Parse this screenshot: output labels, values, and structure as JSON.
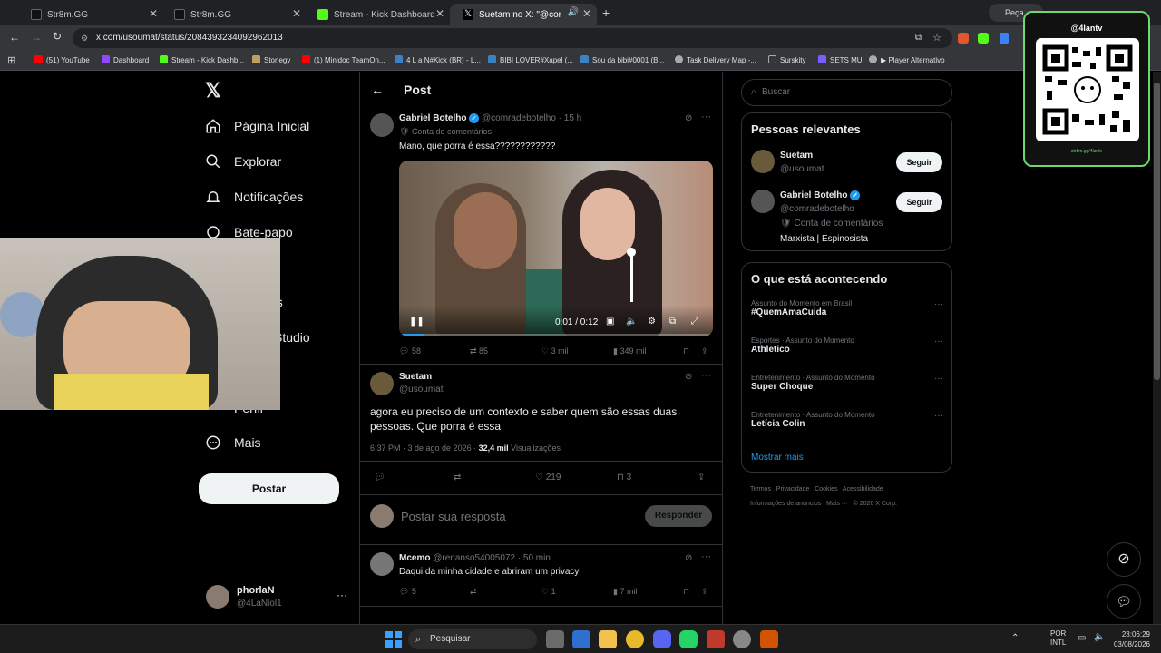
{
  "browser": {
    "tabs": [
      {
        "label": "Str8m.GG",
        "icon_color": "#111111"
      },
      {
        "label": "Str8m.GG",
        "icon_color": "#111111"
      },
      {
        "label": "Stream - Kick Dashboard",
        "icon_color": "#53fc18"
      },
      {
        "label": "Suetam no X: \"@comradeb",
        "icon_color": "#000000"
      }
    ],
    "right_tab": "Peça",
    "url": "x.com/usoumat/status/2084393234092962013",
    "bookmarks": [
      {
        "label": "(51) YouTube",
        "color": "#ff0000"
      },
      {
        "label": "Dashboard",
        "color": "#9147ff"
      },
      {
        "label": "Stream - Kick Dashb...",
        "color": "#53fc18"
      },
      {
        "label": "Stonegy",
        "color": "#c0a060"
      },
      {
        "label": "(1) Minidoc TeamOn...",
        "color": "#ff0000"
      },
      {
        "label": "4 L a N#Kick (BR) - L...",
        "color": "#3b82c4"
      },
      {
        "label": "BIBI LOVER#Xapel (...",
        "color": "#3b82c4"
      },
      {
        "label": "Sou da bibi#0001 (B...",
        "color": "#3b82c4"
      },
      {
        "label": "Task Delivery Map -...",
        "color": "#aaaaaa"
      },
      {
        "label": "Surskity",
        "color": "#aaaaaa"
      },
      {
        "label": "SETS MU",
        "color": "#7a5cff"
      },
      {
        "label": "▶ Player Alternativo",
        "color": "#aaaaaa"
      }
    ]
  },
  "nav": {
    "items": [
      {
        "label": "Página Inicial",
        "icon": "home-icon"
      },
      {
        "label": "Explorar",
        "icon": "search-icon"
      },
      {
        "label": "Notificações",
        "icon": "bell-icon"
      },
      {
        "label": "Bate-papo",
        "icon": "chat-icon"
      },
      {
        "label": "vos",
        "icon": ""
      },
      {
        "label": "Studio",
        "icon": ""
      },
      {
        "label": "Perfil",
        "icon": "profile-icon"
      },
      {
        "label": "Mais",
        "icon": "more-icon"
      }
    ],
    "post_button": "Postar",
    "account_name": "phorlaN",
    "account_handle": "@4LaNlol1"
  },
  "main": {
    "title": "Post",
    "quoted": {
      "name": "Gabriel Botelho",
      "handle": "@comradebotelho",
      "time": "· 15 h",
      "badge": "Conta de comentários",
      "text": "Mano, que porra é essa????????????",
      "video_time": "0:01 / 0:12",
      "video_progress": 0.08,
      "replies": "58",
      "reposts": "85",
      "likes": "3 mil",
      "views": "349 mil"
    },
    "post": {
      "name": "Suetam",
      "handle": "@usoumat",
      "text": "agora eu preciso de um contexto e saber quem são essas duas pessoas. Que porra é essa",
      "timestamp": "6:37 PM · 3 de ago de 2026 ·",
      "views_count": "32,4 mil",
      "views_label": "Visualizações",
      "likes": "219",
      "bookmarks": "3"
    },
    "reply_placeholder": "Postar sua resposta",
    "reply_button": "Responder",
    "reply": {
      "name": "Mcemo",
      "handle": "@renanso54005072",
      "time": "· 50 min",
      "text": "Daqui da minha cidade e abriram um privacy",
      "replies": "5",
      "likes": "1",
      "views": "7 mil"
    }
  },
  "sidebar": {
    "search_placeholder": "Buscar",
    "relevant_title": "Pessoas relevantes",
    "people": [
      {
        "name": "Suetam",
        "handle": "@usoumat",
        "button": "Seguir"
      },
      {
        "name": "Gabriel Botelho",
        "handle": "@comradebotelho",
        "badge": "Conta de comentários",
        "bio": "Marxista | Espinosista",
        "button": "Seguir"
      }
    ],
    "trends_title": "O que está acontecendo",
    "trends": [
      {
        "meta": "Assunto do Momento em Brasil",
        "title": "#QuemAmaCuida"
      },
      {
        "meta": "Esportes · Assunto do Momento",
        "title": "Athletico"
      },
      {
        "meta": "Entretenimento · Assunto do Momento",
        "title": "Super Choque"
      },
      {
        "meta": "Entretenimento · Assunto do Momento",
        "title": "Letícia Colin"
      }
    ],
    "show_more": "Mostrar mais",
    "footer_1": "Termos   Privacidade   Cookies   Acessibilidade",
    "footer_2": "Informações de anúncios   Mais ···   © 2026 X Corp."
  },
  "overlay": {
    "qr_handle": "@4lantv",
    "qr_url": "str8m.gg/4lantv"
  },
  "taskbar": {
    "search": "Pesquisar",
    "lang_1": "POR",
    "lang_2": "INTL",
    "time": "23:06:29",
    "date": "03/08/2026"
  }
}
